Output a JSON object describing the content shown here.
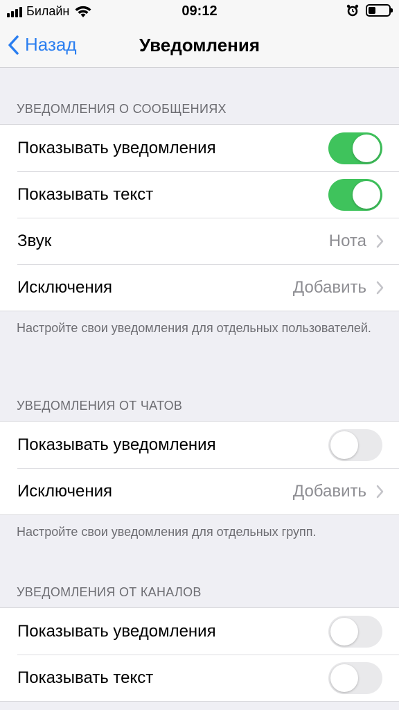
{
  "status_bar": {
    "carrier": "Билайн",
    "time": "09:12",
    "battery_level": 0.35
  },
  "nav": {
    "back_label": "Назад",
    "title": "Уведомления"
  },
  "message_notifications": {
    "header": "УВЕДОМЛЕНИЯ О СООБЩЕНИЯХ",
    "rows": [
      {
        "label": "Показывать уведомления",
        "toggle": true
      },
      {
        "label": "Показывать текст",
        "toggle": true
      },
      {
        "label": "Звук",
        "value": "Нота"
      },
      {
        "label": "Исключения",
        "value": "Добавить"
      }
    ],
    "footer": "Настройте свои уведомления для отдельных пользователей."
  },
  "chat_notifications": {
    "header": "УВЕДОМЛЕНИЯ ОТ ЧАТОВ",
    "rows": [
      {
        "label": "Показывать уведомления",
        "toggle": false
      },
      {
        "label": "Исключения",
        "value": "Добавить"
      }
    ],
    "footer": "Настройте свои уведомления для отдельных групп."
  },
  "channel_notifications": {
    "header": "УВЕДОМЛЕНИЯ ОТ КАНАЛОВ",
    "rows": [
      {
        "label": "Показывать уведомления",
        "toggle": false
      },
      {
        "label": "Показывать текст",
        "toggle": false
      }
    ]
  },
  "colors": {
    "accent": "#2a7ef0",
    "toggle_on": "#3fc35c",
    "toggle_off": "#e9e9eb",
    "background": "#efeff4"
  }
}
